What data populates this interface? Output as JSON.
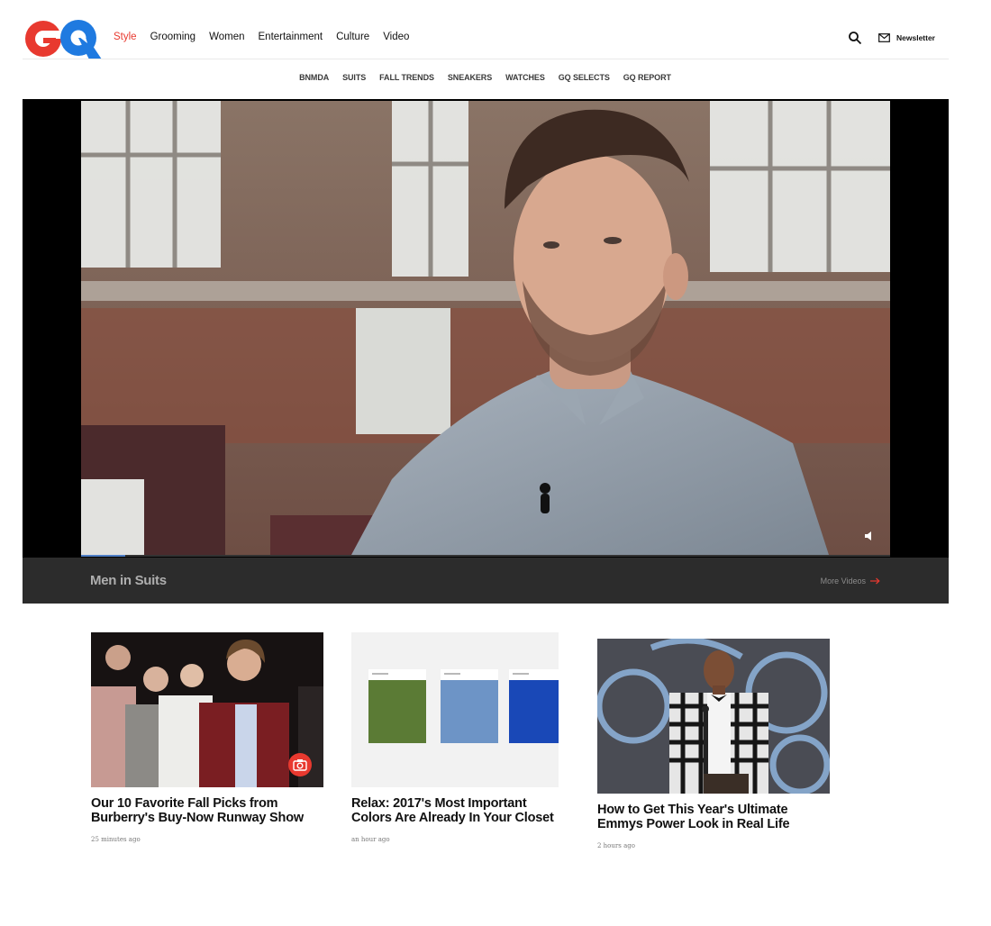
{
  "header": {
    "logo_text": "GQ",
    "nav": [
      {
        "label": "Style",
        "active": true
      },
      {
        "label": "Grooming"
      },
      {
        "label": "Women"
      },
      {
        "label": "Entertainment"
      },
      {
        "label": "Culture"
      },
      {
        "label": "Video"
      }
    ],
    "search_icon": "search-icon",
    "newsletter_icon": "mail-icon",
    "newsletter_label": "Newsletter",
    "accent_color": "#e8392f",
    "logo_red": "#e8392f",
    "logo_blue": "#1f7ae0"
  },
  "subnav": [
    "BNMDA",
    "SUITS",
    "FALL TRENDS",
    "SNEAKERS",
    "WATCHES",
    "GQ SELECTS",
    "GQ REPORT"
  ],
  "video": {
    "title": "Men in Suits",
    "more_label": "More Videos",
    "more_icon": "arrow-right-icon",
    "volume_icon": "volume-icon",
    "progress": 0.055
  },
  "cards": [
    {
      "title": "Our 10 Favorite Fall Picks from Burberry's Buy-Now Runway Show",
      "time": "25 minutes ago",
      "badge_icon": "camera-icon"
    },
    {
      "title": "Relax: 2017's Most Important Colors Are Already In Your Closet",
      "time": "an hour ago"
    },
    {
      "title": "How to Get This Year's Ultimate Emmys Power Look in Real Life",
      "time": "2 hours ago"
    }
  ]
}
